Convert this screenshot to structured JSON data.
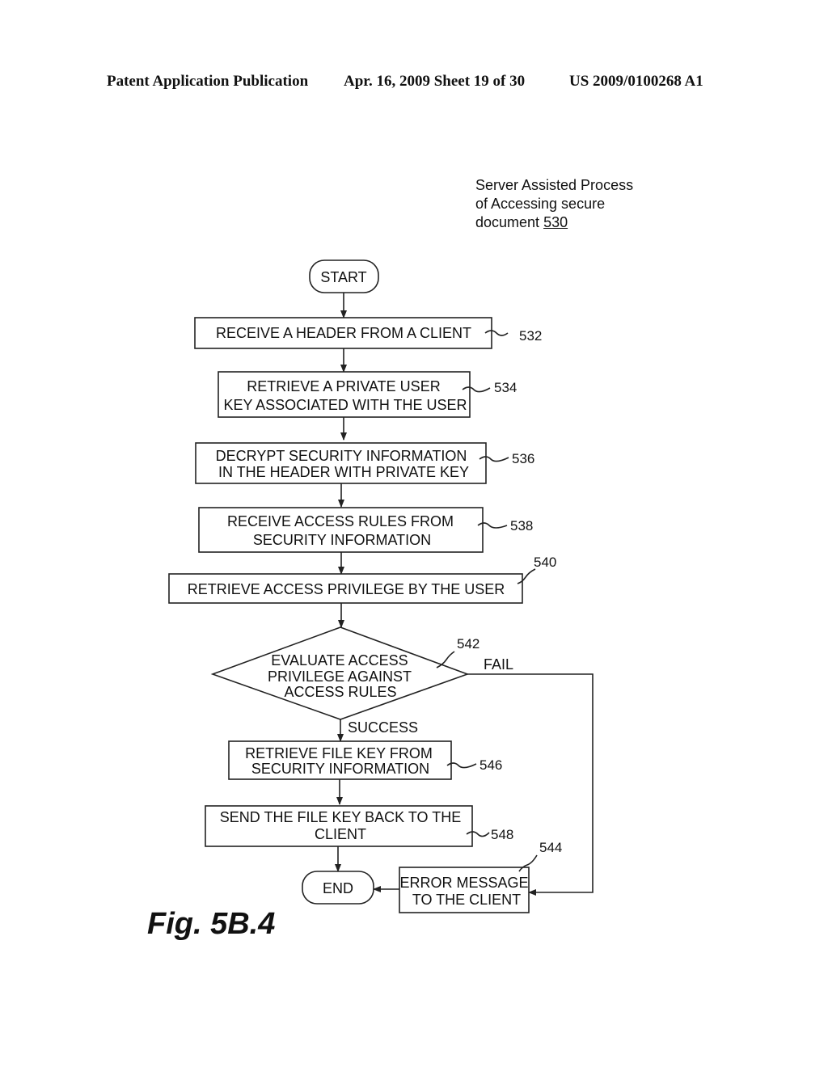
{
  "header": {
    "publication": "Patent Application Publication",
    "date_sheet": "Apr. 16, 2009  Sheet 19 of 30",
    "number": "US 2009/0100268 A1"
  },
  "caption": {
    "line1": "Server Assisted Process",
    "line2": "of Accessing secure",
    "line3_prefix": "document ",
    "ref": "530"
  },
  "flow": {
    "start": "START",
    "end": "END",
    "steps": [
      {
        "ref": "532",
        "lines": [
          "RECEIVE A HEADER FROM A CLIENT"
        ]
      },
      {
        "ref": "534",
        "lines": [
          "RETRIEVE A PRIVATE USER",
          "KEY ASSOCIATED WITH THE USER"
        ]
      },
      {
        "ref": "536",
        "lines": [
          "DECRYPT SECURITY INFORMATION",
          "IN THE HEADER WITH PRIVATE KEY"
        ]
      },
      {
        "ref": "538",
        "lines": [
          "RECEIVE ACCESS RULES FROM",
          "SECURITY INFORMATION"
        ]
      },
      {
        "ref": "540",
        "lines": [
          "RETRIEVE ACCESS PRIVILEGE BY THE USER"
        ]
      },
      {
        "ref": "546",
        "lines": [
          "RETRIEVE FILE KEY FROM",
          "SECURITY INFORMATION"
        ]
      },
      {
        "ref": "548",
        "lines": [
          "SEND THE FILE KEY BACK TO THE",
          "CLIENT"
        ]
      },
      {
        "ref": "544",
        "lines": [
          "ERROR MESSAGE",
          "TO THE CLIENT"
        ]
      }
    ],
    "decision": {
      "ref": "542",
      "lines": [
        "EVALUATE ACCESS",
        "PRIVILEGE AGAINST",
        "ACCESS RULES"
      ],
      "yes_label": "SUCCESS",
      "no_label": "FAIL"
    }
  },
  "figure_label": "Fig. 5B.4"
}
